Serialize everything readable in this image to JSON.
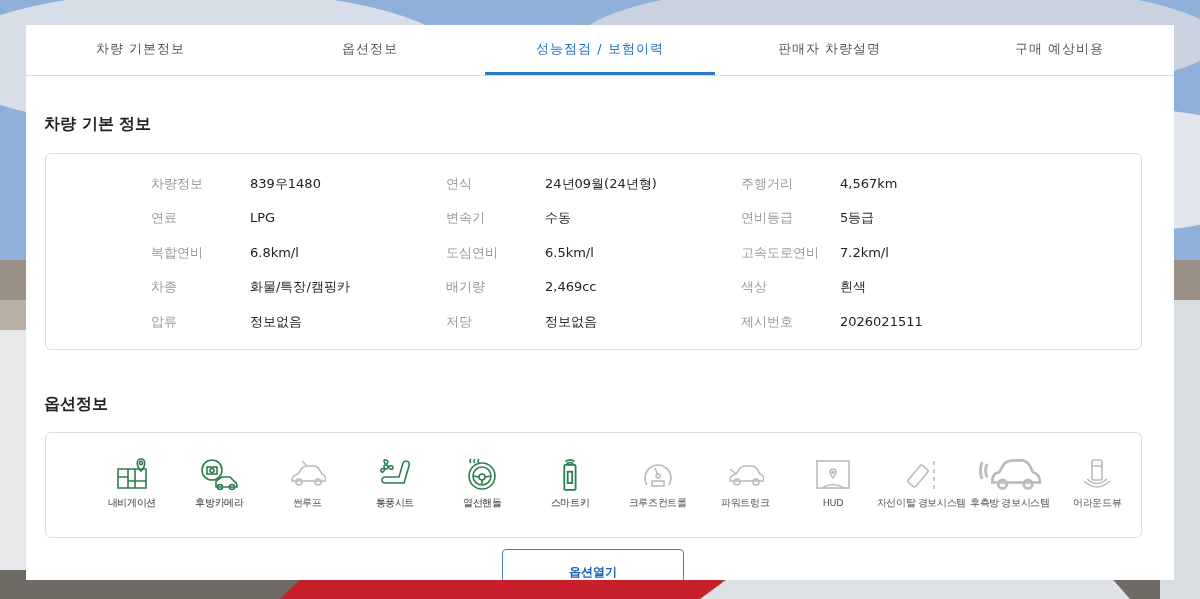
{
  "tabs": [
    {
      "label": "차량 기본정보",
      "selected": false
    },
    {
      "label": "옵션정보",
      "selected": false
    },
    {
      "label": "성능점검 / 보험이력",
      "selected": true
    },
    {
      "label": "판매자 차량설명",
      "selected": false
    },
    {
      "label": "구매 예상비용",
      "selected": false
    }
  ],
  "basic_info": {
    "title": "차량 기본 정보",
    "rows": [
      [
        {
          "label": "차량정보",
          "value": "839우1480"
        },
        {
          "label": "연식",
          "value": "24년09월(24년형)"
        },
        {
          "label": "주행거리",
          "value": "4,567km"
        }
      ],
      [
        {
          "label": "연료",
          "value": "LPG"
        },
        {
          "label": "변속기",
          "value": "수동"
        },
        {
          "label": "연비등급",
          "value": "5등급"
        }
      ],
      [
        {
          "label": "복합연비",
          "value": "6.8km/l"
        },
        {
          "label": "도심연비",
          "value": "6.5km/l"
        },
        {
          "label": "고속도로연비",
          "value": "7.2km/l"
        }
      ],
      [
        {
          "label": "차종",
          "value": "화물/특장/캠핑카"
        },
        {
          "label": "배기량",
          "value": "2,469cc"
        },
        {
          "label": "색상",
          "value": "흰색"
        }
      ],
      [
        {
          "label": "압류",
          "value": "정보없음"
        },
        {
          "label": "저당",
          "value": "정보없음"
        },
        {
          "label": "제시번호",
          "value": "2026021511"
        }
      ]
    ]
  },
  "options": {
    "title": "옵션정보",
    "items": [
      {
        "label": "내비게이션",
        "on": true
      },
      {
        "label": "후방카메라",
        "on": true
      },
      {
        "label": "썬루프",
        "on": false
      },
      {
        "label": "통풍시트",
        "on": true
      },
      {
        "label": "열선핸들",
        "on": true
      },
      {
        "label": "스마트키",
        "on": true
      },
      {
        "label": "크루즈컨트롤",
        "on": false
      },
      {
        "label": "파워트렁크",
        "on": false
      },
      {
        "label": "HUD",
        "on": false
      },
      {
        "label": "차선이탈 경보시스템",
        "on": false
      },
      {
        "label": "후측방 경보시스템",
        "on": false
      },
      {
        "label": "어라운드뷰",
        "on": false
      }
    ],
    "button": "옵션열기"
  }
}
